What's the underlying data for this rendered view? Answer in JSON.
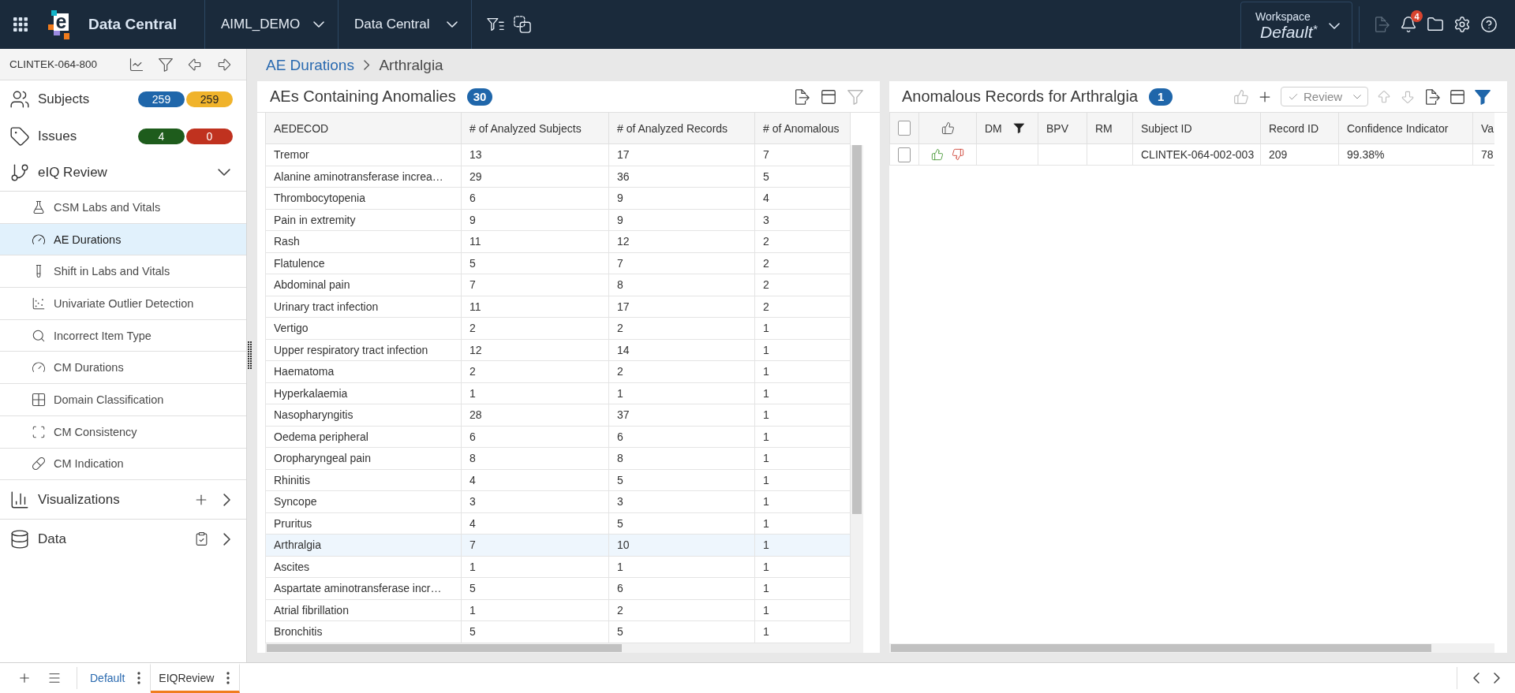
{
  "top_bar": {
    "logo_mark": "e",
    "app_name": "Data Central",
    "selectors": [
      {
        "label": "AIML_DEMO"
      },
      {
        "label": "Data Central"
      }
    ],
    "workspace": {
      "caption": "Workspace",
      "value": "Default$^{*}$"
    },
    "export_disabled": true,
    "notification_count": "4"
  },
  "sidebar": {
    "study": "CLINTEK-064-800",
    "items": [
      {
        "kind": "counter",
        "label": "Subjects",
        "badges": [
          {
            "value": "259",
            "color": "#1f66aa"
          },
          {
            "value": "259",
            "color": "#f0b32b"
          }
        ]
      },
      {
        "kind": "counter",
        "label": "Issues",
        "badges": [
          {
            "value": "4",
            "color": "#1e5c1c"
          },
          {
            "value": "0",
            "color": "#c0321f"
          }
        ]
      },
      {
        "kind": "group",
        "label": "eIQ Review",
        "expanded": true,
        "children": [
          {
            "label": "CSM Labs and Vitals",
            "selected": false
          },
          {
            "label": "AE Durations",
            "selected": true
          },
          {
            "label": "Shift in Labs and Vitals",
            "selected": false
          },
          {
            "label": "Univariate Outlier Detection",
            "selected": false
          },
          {
            "label": "Incorrect Item Type",
            "selected": false
          },
          {
            "label": "CM Durations",
            "selected": false
          },
          {
            "label": "Domain Classification",
            "selected": false
          },
          {
            "label": "CM Consistency",
            "selected": false
          },
          {
            "label": "CM Indication",
            "selected": false
          }
        ]
      },
      {
        "kind": "creatable",
        "label": "Visualizations"
      },
      {
        "kind": "library",
        "label": "Data"
      }
    ]
  },
  "breadcrumb": {
    "parent": "AE Durations",
    "current": "Arthralgia"
  },
  "anomalies_panel": {
    "title": "AEs Containing Anomalies",
    "count": "30",
    "filter_active": false,
    "columns": [
      "AEDECOD",
      "# of Analyzed Subjects",
      "# of Analyzed Records",
      "# of Anomalous"
    ],
    "rows": [
      {
        "cells": [
          "Tremor",
          "13",
          "17",
          "7"
        ],
        "selected": false
      },
      {
        "cells": [
          "Alanine aminotransferase increa…",
          "29",
          "36",
          "5"
        ],
        "selected": false
      },
      {
        "cells": [
          "Thrombocytopenia",
          "6",
          "9",
          "4"
        ],
        "selected": false
      },
      {
        "cells": [
          "Pain in extremity",
          "9",
          "9",
          "3"
        ],
        "selected": false
      },
      {
        "cells": [
          "Rash",
          "11",
          "12",
          "2"
        ],
        "selected": false
      },
      {
        "cells": [
          "Flatulence",
          "5",
          "7",
          "2"
        ],
        "selected": false
      },
      {
        "cells": [
          "Abdominal pain",
          "7",
          "8",
          "2"
        ],
        "selected": false
      },
      {
        "cells": [
          "Urinary tract infection",
          "11",
          "17",
          "2"
        ],
        "selected": false
      },
      {
        "cells": [
          "Vertigo",
          "2",
          "2",
          "1"
        ],
        "selected": false
      },
      {
        "cells": [
          "Upper respiratory tract infection",
          "12",
          "14",
          "1"
        ],
        "selected": false
      },
      {
        "cells": [
          "Haematoma",
          "2",
          "2",
          "1"
        ],
        "selected": false
      },
      {
        "cells": [
          "Hyperkalaemia",
          "1",
          "1",
          "1"
        ],
        "selected": false
      },
      {
        "cells": [
          "Nasopharyngitis",
          "28",
          "37",
          "1"
        ],
        "selected": false
      },
      {
        "cells": [
          "Oedema peripheral",
          "6",
          "6",
          "1"
        ],
        "selected": false
      },
      {
        "cells": [
          "Oropharyngeal pain",
          "8",
          "8",
          "1"
        ],
        "selected": false
      },
      {
        "cells": [
          "Rhinitis",
          "4",
          "5",
          "1"
        ],
        "selected": false
      },
      {
        "cells": [
          "Syncope",
          "3",
          "3",
          "1"
        ],
        "selected": false
      },
      {
        "cells": [
          "Pruritus",
          "4",
          "5",
          "1"
        ],
        "selected": false
      },
      {
        "cells": [
          "Arthralgia",
          "7",
          "10",
          "1"
        ],
        "selected": true
      },
      {
        "cells": [
          "Ascites",
          "1",
          "1",
          "1"
        ],
        "selected": false
      },
      {
        "cells": [
          "Aspartate aminotransferase incr…",
          "5",
          "6",
          "1"
        ],
        "selected": false
      },
      {
        "cells": [
          "Atrial fibrillation",
          "1",
          "2",
          "1"
        ],
        "selected": false
      },
      {
        "cells": [
          "Bronchitis",
          "5",
          "5",
          "1"
        ],
        "selected": false
      }
    ]
  },
  "records_panel": {
    "title": "Anomalous Records for Arthralgia",
    "count": "1",
    "selection_actions_disabled": true,
    "review": {
      "label": "Review"
    },
    "filter_active": true,
    "all_checked": false,
    "columns": [
      {
        "label": "DM",
        "filtered": true
      },
      {
        "label": "BPV",
        "filtered": false
      },
      {
        "label": "RM",
        "filtered": false
      },
      {
        "label": "Subject ID",
        "filtered": false
      },
      {
        "label": "Record ID",
        "filtered": false
      },
      {
        "label": "Confidence Indicator",
        "filtered": false
      },
      {
        "label": "Va",
        "filtered": false
      }
    ],
    "rows": [
      {
        "checked": false,
        "cells": [
          "",
          "",
          "",
          "CLINTEK-064-002-003",
          "209",
          "99.38%",
          "78"
        ]
      }
    ]
  },
  "bottom_tabs": [
    {
      "label": "Default",
      "selected": false
    },
    {
      "label": "EIQReview",
      "selected": true
    }
  ]
}
